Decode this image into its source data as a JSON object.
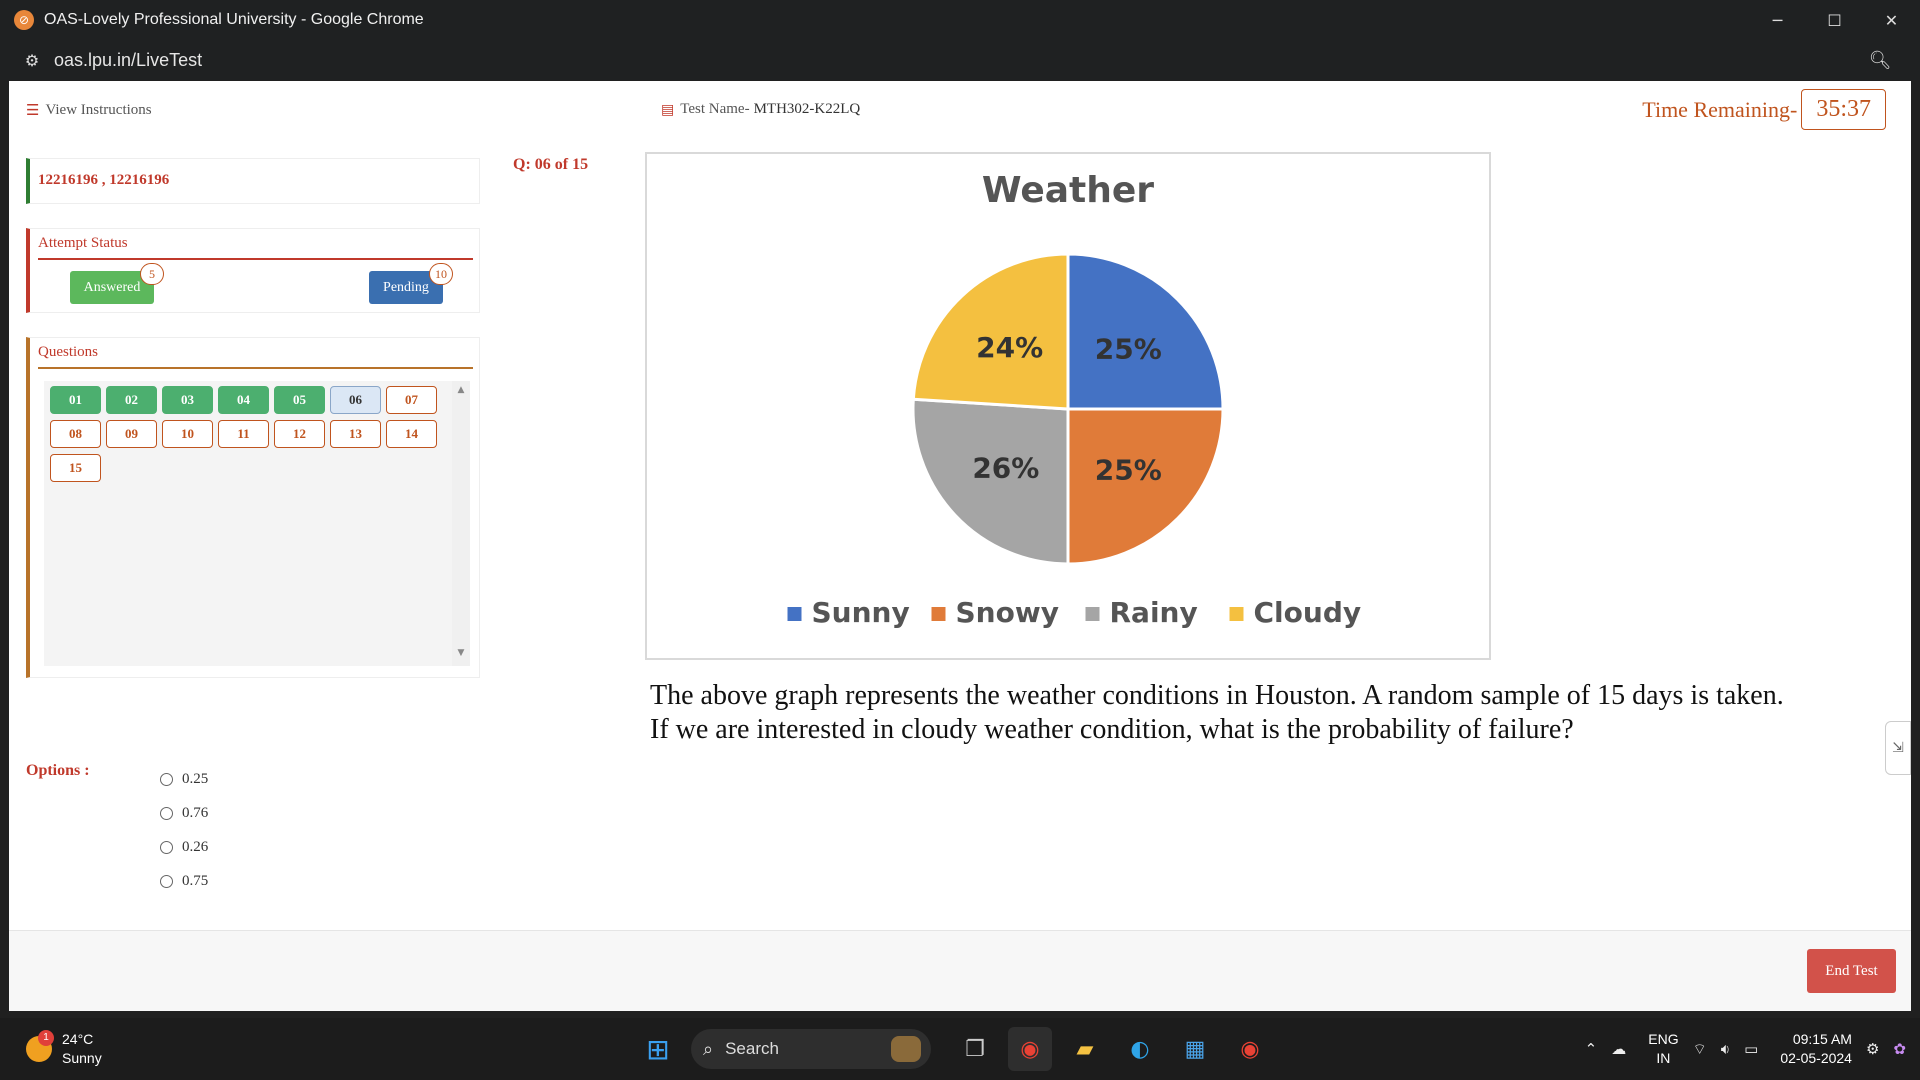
{
  "browser": {
    "title": "OAS-Lovely Professional University - Google Chrome",
    "url": "oas.lpu.in/LiveTest"
  },
  "header": {
    "view_instructions": "View Instructions",
    "test_name_label": "Test Name-",
    "test_name_value": "MTH302-K22LQ",
    "time_label": "Time Remaining-",
    "time_value": "35:37"
  },
  "student": {
    "ids": "12216196 , 12216196"
  },
  "attempt_status": {
    "heading": "Attempt Status",
    "answered_label": "Answered",
    "answered_count": "5",
    "pending_label": "Pending",
    "pending_count": "10"
  },
  "questions_panel": {
    "heading": "Questions",
    "items": [
      {
        "label": "01",
        "state": "answered"
      },
      {
        "label": "02",
        "state": "answered"
      },
      {
        "label": "03",
        "state": "answered"
      },
      {
        "label": "04",
        "state": "answered"
      },
      {
        "label": "05",
        "state": "answered"
      },
      {
        "label": "06",
        "state": "current"
      },
      {
        "label": "07",
        "state": "pending"
      },
      {
        "label": "08",
        "state": "pending"
      },
      {
        "label": "09",
        "state": "pending"
      },
      {
        "label": "10",
        "state": "pending"
      },
      {
        "label": "11",
        "state": "pending"
      },
      {
        "label": "12",
        "state": "pending"
      },
      {
        "label": "13",
        "state": "pending"
      },
      {
        "label": "14",
        "state": "pending"
      },
      {
        "label": "15",
        "state": "pending"
      }
    ]
  },
  "question": {
    "number": "Q: 06 of 15",
    "line1": "The above graph represents the weather conditions in Houston. A random sample of 15 days is taken.",
    "line2": "If we are interested in cloudy weather condition, what is the probability of failure?"
  },
  "chart_data": {
    "type": "pie",
    "title": "Weather",
    "categories": [
      "Sunny",
      "Snowy",
      "Rainy",
      "Cloudy"
    ],
    "values": [
      25,
      25,
      26,
      24
    ],
    "labels": [
      "25%",
      "25%",
      "26%",
      "24%"
    ],
    "colors": [
      "#4472c4",
      "#e07b39",
      "#a5a5a5",
      "#f4c040"
    ],
    "legend": "bottom"
  },
  "options": {
    "label": "Options :",
    "items": [
      "0.25",
      "0.76",
      "0.26",
      "0.75"
    ]
  },
  "footer": {
    "end_test": "End Test"
  },
  "taskbar": {
    "temperature": "24°C",
    "weather": "Sunny",
    "weather_notif": "1",
    "search": "Search",
    "lang1": "ENG",
    "lang2": "IN",
    "time": "09:15 AM",
    "date": "02-05-2024"
  }
}
